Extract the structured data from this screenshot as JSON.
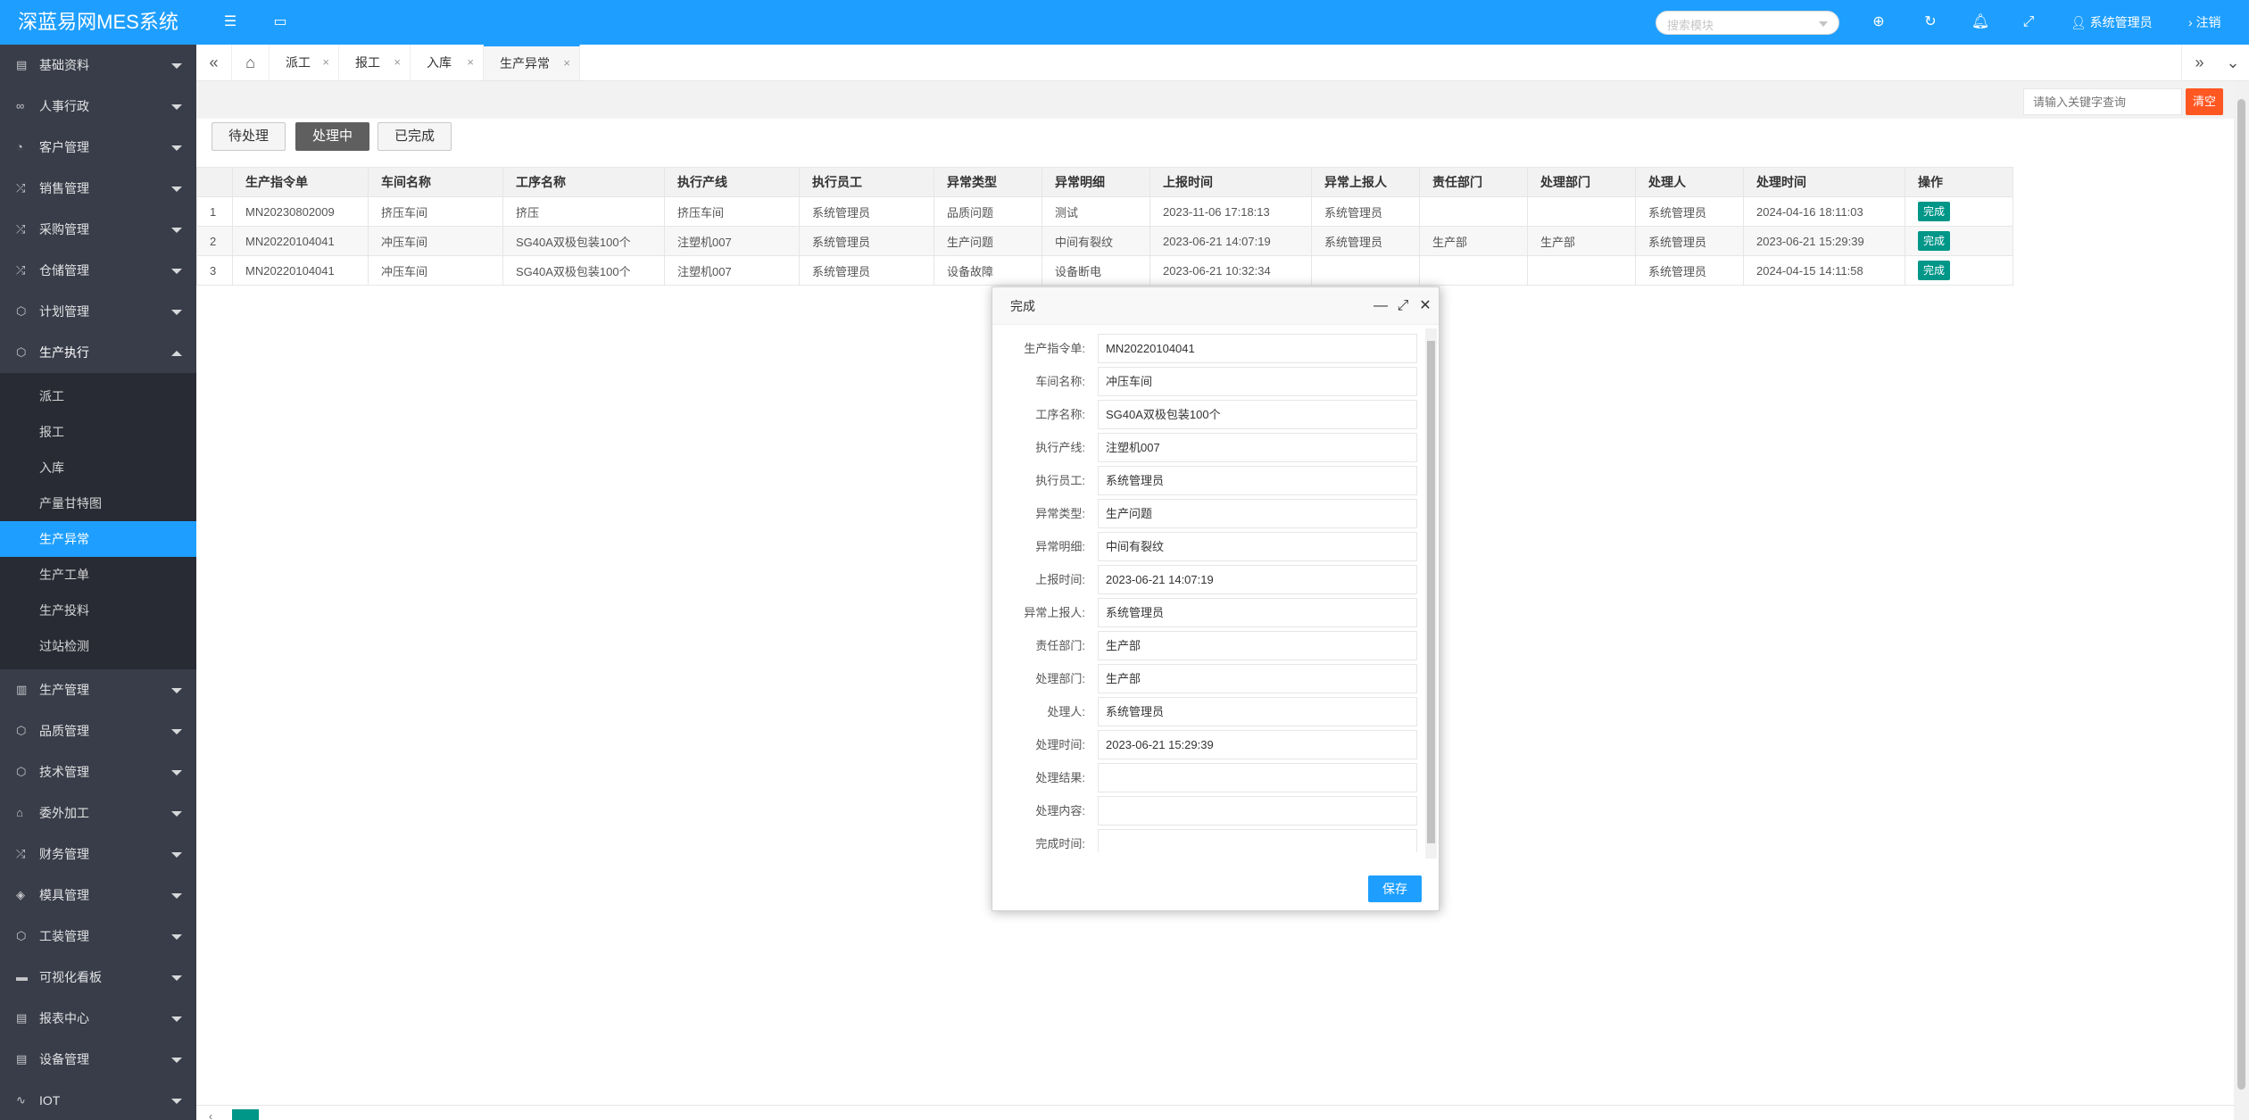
{
  "app": {
    "title": "深蓝易网MES系统"
  },
  "header": {
    "search_placeholder": "搜索模块",
    "user_name": "系统管理员",
    "logout_label": "注销"
  },
  "sidebar": {
    "menus": [
      {
        "label": "基础资料"
      },
      {
        "label": "人事行政"
      },
      {
        "label": "客户管理"
      },
      {
        "label": "销售管理"
      },
      {
        "label": "采购管理"
      },
      {
        "label": "仓储管理"
      },
      {
        "label": "计划管理"
      },
      {
        "label": "生产执行"
      },
      {
        "label": "生产管理"
      },
      {
        "label": "品质管理"
      },
      {
        "label": "技术管理"
      },
      {
        "label": "委外加工"
      },
      {
        "label": "财务管理"
      },
      {
        "label": "模具管理"
      },
      {
        "label": "工装管理"
      },
      {
        "label": "可视化看板"
      },
      {
        "label": "报表中心"
      },
      {
        "label": "设备管理"
      },
      {
        "label": "IOT"
      }
    ],
    "production_submenu": [
      {
        "label": "派工"
      },
      {
        "label": "报工"
      },
      {
        "label": "入库"
      },
      {
        "label": "产量甘特图"
      },
      {
        "label": "生产异常"
      },
      {
        "label": "生产工单"
      },
      {
        "label": "生产投料"
      },
      {
        "label": "过站检测"
      }
    ]
  },
  "tabs": [
    {
      "label": "派工"
    },
    {
      "label": "报工"
    },
    {
      "label": "入库"
    },
    {
      "label": "生产异常"
    }
  ],
  "toolbar": {
    "keyword_placeholder": "请输入关键字查询",
    "clear_label": "清空"
  },
  "status_filters": [
    {
      "label": "待处理"
    },
    {
      "label": "处理中"
    },
    {
      "label": "已完成"
    }
  ],
  "table": {
    "columns": [
      "生产指令单",
      "车间名称",
      "工序名称",
      "执行产线",
      "执行员工",
      "异常类型",
      "异常明细",
      "上报时间",
      "异常上报人",
      "责任部门",
      "处理部门",
      "处理人",
      "处理时间",
      "操作"
    ],
    "rows": [
      {
        "index": "1",
        "cells": [
          "MN20230802009",
          "挤压车间",
          "挤压",
          "挤压车间",
          "系统管理员",
          "品质问题",
          "测试",
          "2023-11-06 17:18:13",
          "系统管理员",
          "",
          "",
          "系统管理员",
          "2024-04-16 18:11:03"
        ],
        "action": "完成"
      },
      {
        "index": "2",
        "cells": [
          "MN20220104041",
          "冲压车间",
          "SG40A双极包装100个",
          "注塑机007",
          "系统管理员",
          "生产问题",
          "中间有裂纹",
          "2023-06-21 14:07:19",
          "系统管理员",
          "生产部",
          "生产部",
          "系统管理员",
          "2023-06-21 15:29:39"
        ],
        "action": "完成"
      },
      {
        "index": "3",
        "cells": [
          "MN20220104041",
          "冲压车间",
          "SG40A双极包装100个",
          "注塑机007",
          "系统管理员",
          "设备故障",
          "设备断电",
          "2023-06-21 10:32:34",
          "",
          "",
          "",
          "系统管理员",
          "2024-04-15 14:11:58"
        ],
        "action": "完成"
      }
    ]
  },
  "modal": {
    "title": "完成",
    "fields": [
      {
        "label": "生产指令单:",
        "value": "MN20220104041"
      },
      {
        "label": "车间名称:",
        "value": "冲压车间"
      },
      {
        "label": "工序名称:",
        "value": "SG40A双极包装100个"
      },
      {
        "label": "执行产线:",
        "value": "注塑机007"
      },
      {
        "label": "执行员工:",
        "value": "系统管理员"
      },
      {
        "label": "异常类型:",
        "value": "生产问题"
      },
      {
        "label": "异常明细:",
        "value": "中间有裂纹"
      },
      {
        "label": "上报时间:",
        "value": "2023-06-21 14:07:19"
      },
      {
        "label": "异常上报人:",
        "value": "系统管理员"
      },
      {
        "label": "责任部门:",
        "value": "生产部"
      },
      {
        "label": "处理部门:",
        "value": "生产部"
      },
      {
        "label": "处理人:",
        "value": "系统管理员"
      },
      {
        "label": "处理时间:",
        "value": "2023-06-21 15:29:39"
      },
      {
        "label": "处理结果:",
        "value": ""
      },
      {
        "label": "处理内容:",
        "value": ""
      },
      {
        "label": "完成时间:",
        "value": ""
      }
    ],
    "save_label": "保存"
  },
  "icons": {
    "menu_toggle": "menu-icon",
    "browser": "window-icon",
    "globe": "globe-icon",
    "refresh": "refresh-icon",
    "bell": "bell-icon",
    "fullscreen": "fullscreen-icon",
    "user": "user-icon"
  },
  "colors": {
    "primary": "#1e9fff",
    "sidebar": "#393d49",
    "success": "#009688",
    "danger": "#ff5722"
  }
}
